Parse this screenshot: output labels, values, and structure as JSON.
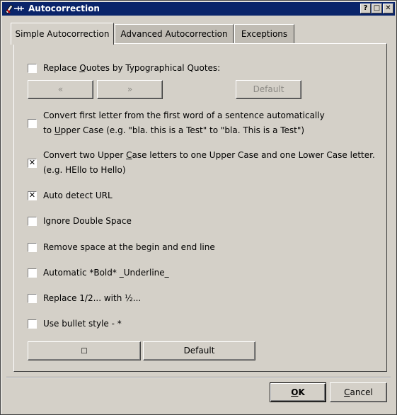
{
  "window": {
    "title": "Autocorrection",
    "controls": [
      "?",
      "□",
      "✕"
    ]
  },
  "tabs": [
    {
      "label": "Simple Autocorrection",
      "active": true
    },
    {
      "label": "Advanced Autocorrection",
      "active": false
    },
    {
      "label": "Exceptions",
      "active": false
    }
  ],
  "options": {
    "replace_quotes": {
      "pre": "Replace ",
      "ul": "Q",
      "post": "uotes by Typographical Quotes:",
      "checked": false
    },
    "quote_buttons": {
      "left": "«",
      "right": "»",
      "default": "Default"
    },
    "convert_first": {
      "line1": "Convert first letter from the first word of a sentence automatically",
      "line2_pre": "to ",
      "line2_ul": "U",
      "line2_post": "pper Case (e.g. \"bla. this is a Test\" to \"bla. This is a Test\")",
      "checked": false
    },
    "convert_two": {
      "line1_pre": "Convert two Upper ",
      "line1_ul": "C",
      "line1_post": "ase letters to one Upper Case and one Lower Case letter.",
      "line2": "(e.g. HEllo to Hello)",
      "checked": true
    },
    "auto_url": {
      "label": "Auto detect URL",
      "checked": true
    },
    "ignore_double": {
      "label": "Ignore Double Space",
      "checked": false
    },
    "remove_space": {
      "label": "Remove space at the begin and end line",
      "checked": false
    },
    "auto_bold": {
      "label": "Automatic *Bold* _Underline_",
      "checked": false
    },
    "replace_half": {
      "label": "Replace 1/2... with ½...",
      "checked": false
    },
    "bullet_style": {
      "label": "Use bullet style - *",
      "checked": false
    },
    "bullet_buttons": {
      "symbol": "□",
      "default": "Default"
    }
  },
  "footer": {
    "ok": {
      "ul": "O",
      "rest": "K"
    },
    "cancel": {
      "ul": "C",
      "rest": "ancel"
    }
  },
  "colors": {
    "titlebar": "#0a246a",
    "face": "#d4d0c8"
  }
}
